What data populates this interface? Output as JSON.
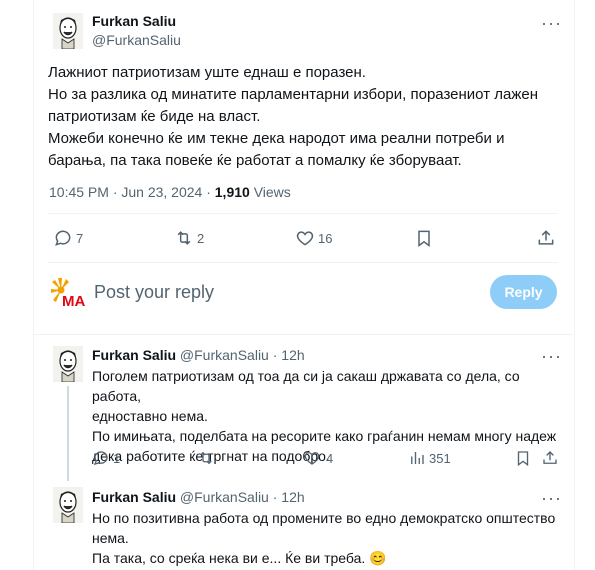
{
  "main_tweet": {
    "author_name": "Furkan Saliu",
    "author_handle": "@FurkanSaliu",
    "lines": [
      "Лажниот патриотизам уште еднаш е поразен.",
      "Но за разлика од минатите парламентарни избори, поразениот лажен",
      "патриотизам ќе биде на власт.",
      "Можеби конечно ќе им текне дека народот има реални потреби и",
      "барања, па така повеќе ќе работат а помалку ќе зборуваат."
    ],
    "timestamp": "10:45 PM · Jun 23, 2024 · ",
    "views_count": "1,910",
    "views_label": " Views",
    "replies": "7",
    "retweets": "2",
    "likes": "16"
  },
  "composer": {
    "placeholder": "Post your reply",
    "button_label": "Reply",
    "avatar_text": "MA",
    "colors": {
      "avatar_primary": "#e30613",
      "avatar_secondary": "#f5a000"
    }
  },
  "replies": [
    {
      "author_name": "Furkan Saliu",
      "author_handle": "@FurkanSaliu",
      "time": "· 12h",
      "lines": [
        "Поголем патриотизам од тоа да си ја сакаш државата со дела, со работа,",
        "едноставно нема.",
        "По имињата, поделбата на ресорите како граѓанин немам многу надеж",
        "дека работите ќе тргнат на подобро."
      ],
      "replies": "1",
      "retweets": "",
      "likes": "4",
      "views": "351"
    },
    {
      "author_name": "Furkan Saliu",
      "author_handle": "@FurkanSaliu",
      "time": "· 12h",
      "lines": [
        "Но по позитивна работа од промените во едно демократско општество",
        "нема.",
        "Па така, со среќа нека ви е... Ќе ви треба. 😊"
      ]
    }
  ],
  "colors": {
    "accent": "#1d9bf0",
    "reply_button": "#8ecdf8",
    "secondary_text": "#536471",
    "divider": "#eff3f4"
  },
  "icons": {
    "reply": "speech-bubble-icon",
    "retweet": "retweet-icon",
    "like": "heart-icon",
    "bookmark": "bookmark-icon",
    "share": "share-icon",
    "views": "bar-chart-icon",
    "more": "more-icon"
  }
}
